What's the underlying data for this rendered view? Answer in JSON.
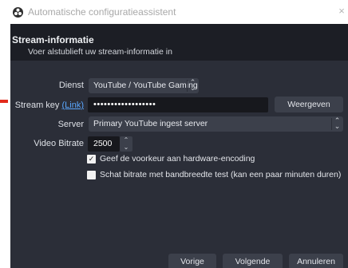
{
  "window": {
    "title": "Automatische configuratieassistent",
    "close_glyph": "×"
  },
  "header": {
    "title": "Stream-informatie",
    "subtitle": "Voer alstublieft uw stream-informatie in"
  },
  "form": {
    "service": {
      "label": "Dienst",
      "value": "YouTube / YouTube Gaming"
    },
    "stream_key": {
      "label": "Stream key",
      "link": "(Link)",
      "masked_value": "••••••••••••••••••",
      "show_button": "Weergeven"
    },
    "server": {
      "label": "Server",
      "value": "Primary YouTube ingest server"
    },
    "video_bitrate": {
      "label": "Video Bitrate",
      "value": "2500"
    },
    "hardware_encoding": {
      "label": "Geef de voorkeur aan hardware-encoding",
      "checked": true
    },
    "bandwidth_test": {
      "label": "Schat bitrate met bandbreedte test (kan een paar minuten duren)",
      "checked": false
    }
  },
  "buttons": {
    "back": "Vorige",
    "next": "Volgende",
    "cancel": "Annuleren"
  },
  "icons": {
    "app": "obs-logo-icon",
    "close": "close-icon",
    "combo": "up-down-chevron-icon",
    "check": "checkmark-icon"
  },
  "colors": {
    "window_bg": "#2b2e38",
    "header_bg": "#1c1e25",
    "input_bg": "#17181d",
    "control_bg": "#3c404b",
    "link": "#5aa7ff"
  }
}
